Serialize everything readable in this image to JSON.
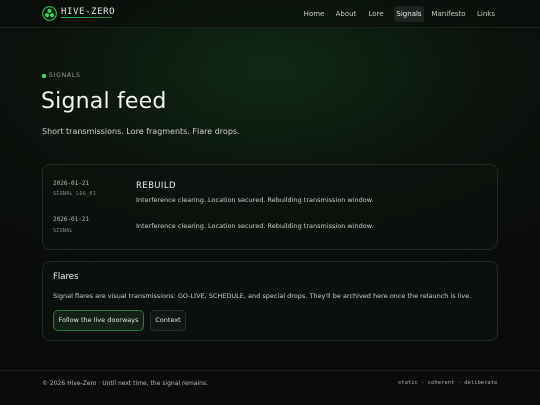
{
  "header": {
    "brand": "HIVE-ZERO",
    "nav": [
      {
        "label": "Home"
      },
      {
        "label": "About"
      },
      {
        "label": "Lore"
      },
      {
        "label": "Signals",
        "active": true
      },
      {
        "label": "Manifesto"
      },
      {
        "label": "Links"
      }
    ]
  },
  "hero": {
    "kicker": "SIGNALS",
    "title": "Signal feed",
    "subtitle": "Short transmissions. Lore fragments. Flare drops."
  },
  "feed": {
    "entries": [
      {
        "date": "2026-01-21",
        "tag": "SIGNAL_LOG_01",
        "title": "REBUILD",
        "body": "Interference clearing. Location secured. Rebuilding transmission window."
      },
      {
        "date": "2026-01-21",
        "tag": "SIGNAL",
        "title": "",
        "body": "Interference clearing. Location secured. Rebuilding transmission window."
      }
    ]
  },
  "flares": {
    "title": "Flares",
    "body": "Signal flares are visual transmissions: GO-LIVE, SCHEDULE, and special drops. They'll be archived here once the relaunch is live.",
    "primary_button": "Follow the live doorways",
    "secondary_button": "Context"
  },
  "footer": {
    "copyright": "© 2026 Hive-Zero · Until next time, the signal remains.",
    "tagline": "static · coherent · deliberate"
  },
  "colors": {
    "accent": "#3bd35a",
    "background": "#0b0d0b"
  }
}
